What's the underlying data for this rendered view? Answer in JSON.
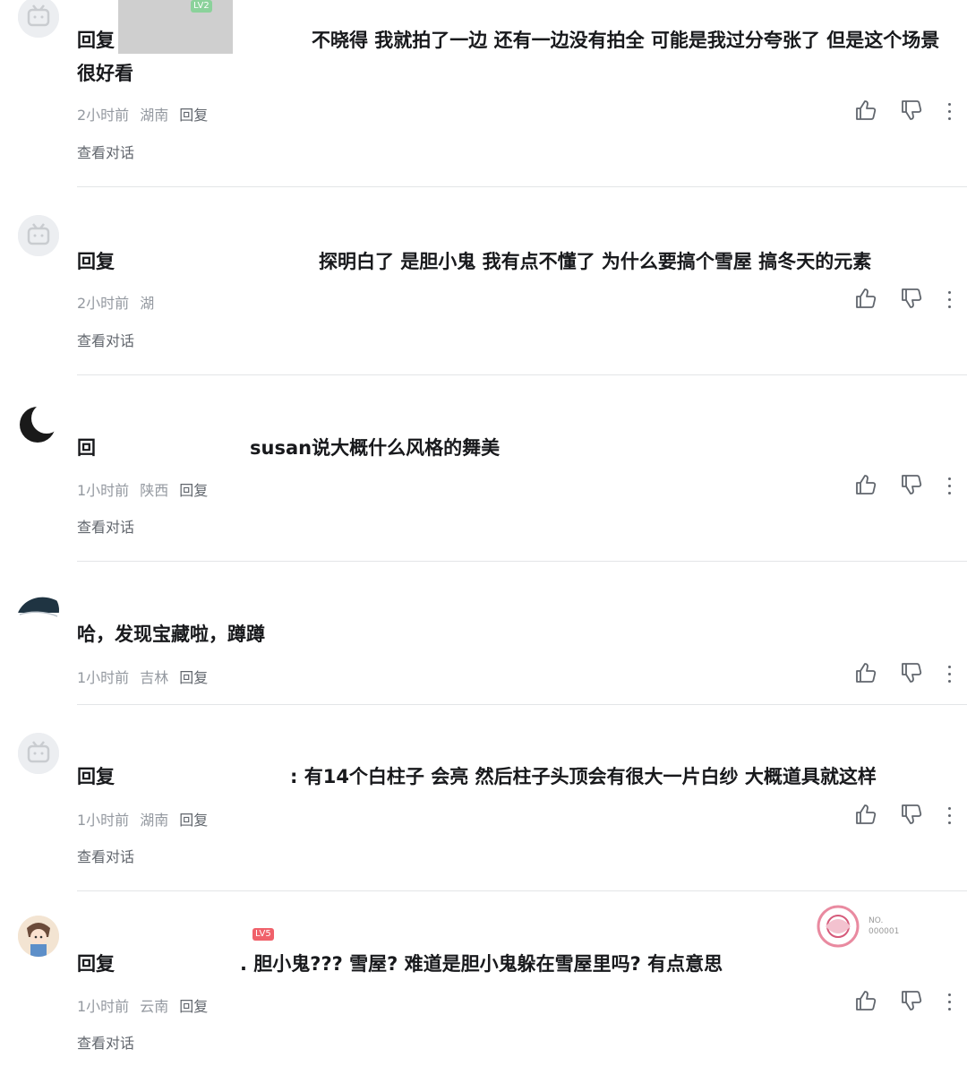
{
  "comments": [
    {
      "reply_prefix": "回复",
      "level": "LV2",
      "text": "不晓得 我就拍了一边 还有一边没有拍全 可能是我过分夸张了 但是这个场景很好看",
      "time": "2小时前",
      "region": "湖南",
      "reply": "回复",
      "view_conversation": "查看对话",
      "avatar_icon": "default-tv-avatar"
    },
    {
      "reply_prefix": "回复",
      "text": "探明白了 是胆小鬼 我有点不懂了 为什么要搞个雪屋 搞冬天的元素",
      "time": "2小时前",
      "region": "湖",
      "reply": "回复",
      "view_conversation": "查看对话",
      "avatar_icon": "default-tv-avatar"
    },
    {
      "reply_prefix": "回",
      "text": "susan说大概什么风格的舞美",
      "time": "1小时前",
      "region": "陕西",
      "reply": "回复",
      "view_conversation": "查看对话",
      "avatar_icon": "crescent-moon-avatar"
    },
    {
      "text": "哈，发现宝藏啦，蹲蹲",
      "time": "1小时前",
      "region": "吉林",
      "reply": "回复",
      "avatar_icon": "dark-landscape-avatar"
    },
    {
      "reply_prefix": "回复",
      "text": ": 有14个白柱子 会亮 然后柱子头顶会有很大一片白纱 大概道具就这样",
      "time": "1小时前",
      "region": "湖南",
      "reply": "回复",
      "view_conversation": "查看对话",
      "avatar_icon": "default-tv-avatar"
    },
    {
      "reply_prefix": "回复",
      "level": "LV5",
      "text": ". 胆小鬼??? 雪屋? 难道是胆小鬼躲在雪屋里吗? 有点意思",
      "time": "1小时前",
      "region": "云南",
      "reply": "回复",
      "view_conversation": "查看对话",
      "avatar_icon": "anime-character-avatar"
    }
  ],
  "colors": {
    "text": "#18191c",
    "meta": "#9499a0",
    "divider": "#e3e5e7",
    "icon": "#61666d"
  }
}
